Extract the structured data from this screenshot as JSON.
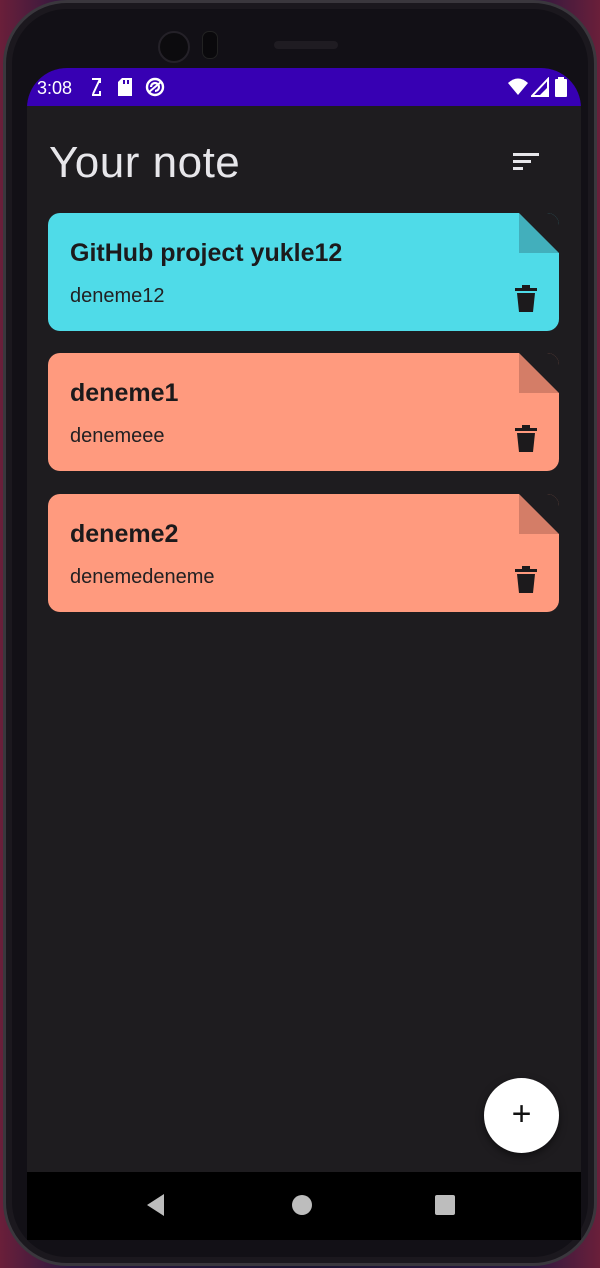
{
  "status_bar": {
    "time": "3:08",
    "icons": [
      "rotate-icon",
      "sd-card-icon",
      "sync-icon",
      "wifi-icon",
      "signal-icon",
      "battery-icon"
    ],
    "color": "#3700b3"
  },
  "header": {
    "title": "Your note",
    "sort_icon": "sort-icon"
  },
  "notes": [
    {
      "title": "GitHub project yukle12",
      "body": "deneme12",
      "color": "#4fdbe8",
      "fold_color": "#42afbc"
    },
    {
      "title": "deneme1",
      "body": "denemeee",
      "color": "#ff9a7e",
      "fold_color": "#d47d67"
    },
    {
      "title": "deneme2",
      "body": "denemedeneme",
      "color": "#ff9a7e",
      "fold_color": "#d47d67"
    }
  ],
  "fab": {
    "label": "+",
    "icon": "add-icon"
  },
  "nav_bar": {
    "buttons": [
      "back-icon",
      "home-icon",
      "recents-icon"
    ]
  },
  "colors": {
    "background": "#1e1c1f",
    "text": "#e7e6ea"
  }
}
